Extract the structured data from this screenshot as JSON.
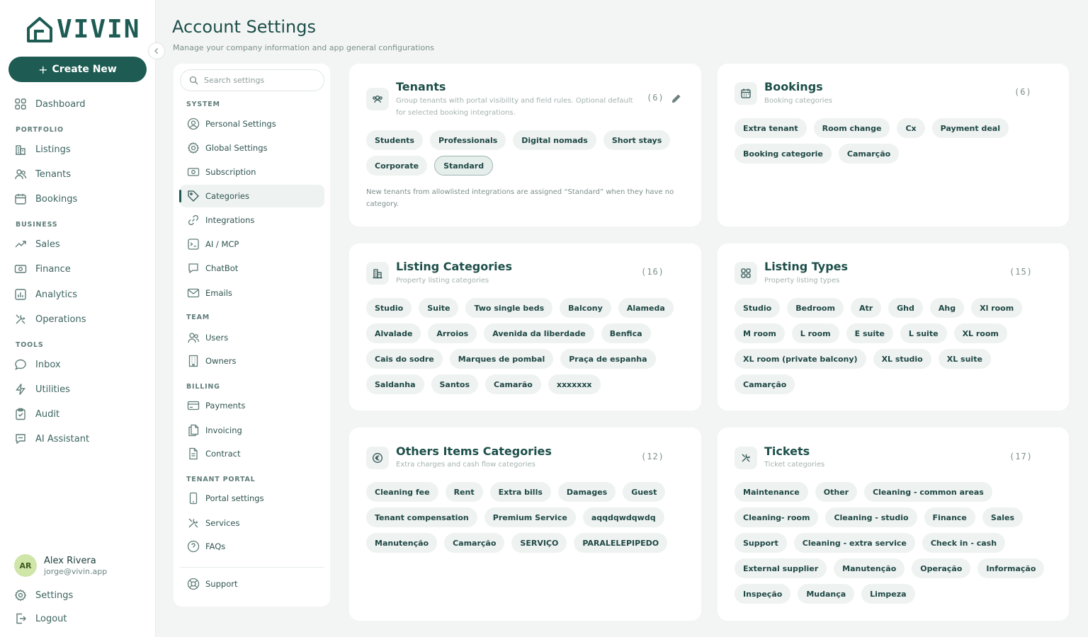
{
  "brand": {
    "name": "VIVIN"
  },
  "nav": {
    "create_label": "Create New",
    "dashboard": "Dashboard",
    "sections": {
      "portfolio": "PORTFOLIO",
      "business": "BUSINESS",
      "tools": "TOOLS"
    },
    "portfolio": [
      "Listings",
      "Tenants",
      "Bookings"
    ],
    "business": [
      "Sales",
      "Finance",
      "Analytics",
      "Operations"
    ],
    "tools": [
      "Inbox",
      "Utilities",
      "Audit",
      "AI Assistant"
    ],
    "settings": "Settings",
    "logout": "Logout"
  },
  "user": {
    "initials": "AR",
    "name": "Alex Rivera",
    "email": "jorge@vivin.app"
  },
  "page": {
    "title": "Account Settings",
    "subtitle": "Manage your company information and app general configurations"
  },
  "menu": {
    "search_placeholder": "Search settings",
    "sections": {
      "system": "SYSTEM",
      "team": "TEAM",
      "billing": "BILLING",
      "portal": "TENANT PORTAL"
    },
    "system": [
      "Personal Settings",
      "Global Settings",
      "Subscription",
      "Categories",
      "Integrations",
      "AI / MCP",
      "ChatBot",
      "Emails"
    ],
    "team": [
      "Users",
      "Owners"
    ],
    "billing": [
      "Payments",
      "Invoicing",
      "Contract"
    ],
    "portal": [
      "Portal settings",
      "Services",
      "FAQs"
    ],
    "support": "Support"
  },
  "cards": {
    "tenants": {
      "title": "Tenants",
      "subtitle": "Group tenants with portal visibility and field rules. Optional default for selected booking integrations.",
      "count": "(6)",
      "chips": [
        "Students",
        "Professionals",
        "Digital nomads",
        "Short stays",
        "Corporate",
        "Standard"
      ],
      "note": "New tenants from allowlisted integrations are assigned “Standard” when they have no category."
    },
    "bookings": {
      "title": "Bookings",
      "subtitle": "Booking categories",
      "count": "(6)",
      "chips": [
        "Extra tenant",
        "Room change",
        "Cx",
        "Payment deal",
        "Booking categorie",
        "Camarção"
      ]
    },
    "listing_categories": {
      "title": "Listing Categories",
      "subtitle": "Property listing categories",
      "count": "(16)",
      "chips": [
        "Studio",
        "Suite",
        "Two single beds",
        "Balcony",
        "Alameda",
        "Alvalade",
        "Arroios",
        "Avenida da liberdade",
        "Benfica",
        "Cais do sodre",
        "Marques de pombal",
        "Praça de espanha",
        "Saldanha",
        "Santos",
        "Camarão",
        "xxxxxxx"
      ]
    },
    "listing_types": {
      "title": "Listing Types",
      "subtitle": "Property listing types",
      "count": "(15)",
      "chips": [
        "Studio",
        "Bedroom",
        "Atr",
        "Ghd",
        "Ahg",
        "Xl room",
        "M room",
        "L room",
        "E suite",
        "L suite",
        "XL room",
        "XL room (private balcony)",
        "XL studio",
        "XL suite",
        "Camarção"
      ]
    },
    "other_items": {
      "title": "Others Items Categories",
      "subtitle": "Extra charges and cash flow categories",
      "count": "(12)",
      "chips": [
        "Cleaning fee",
        "Rent",
        "Extra bills",
        "Damages",
        "Guest",
        "Tenant compensation",
        "Premium Service",
        "aqqdqwdqwdq",
        "Manutenção",
        "Camarção",
        "SERVIÇO",
        "PARALELEPIPEDO"
      ]
    },
    "tickets": {
      "title": "Tickets",
      "subtitle": "Ticket categories",
      "count": "(17)",
      "chips": [
        "Maintenance",
        "Other",
        "Cleaning - common areas",
        "Cleaning- room",
        "Cleaning - studio",
        "Finance",
        "Sales",
        "Support",
        "Cleaning - extra service",
        "Check in - cash",
        "External supplier",
        "Manutenção",
        "Operação",
        "Informação",
        "Inspeção",
        "Mudança",
        "Limpeza"
      ]
    }
  },
  "selected_tenant_chip": "Standard",
  "colors": {
    "brand": "#1d5b53",
    "chip_bg": "#eef2f1",
    "page_bg": "#f3f5f4"
  }
}
